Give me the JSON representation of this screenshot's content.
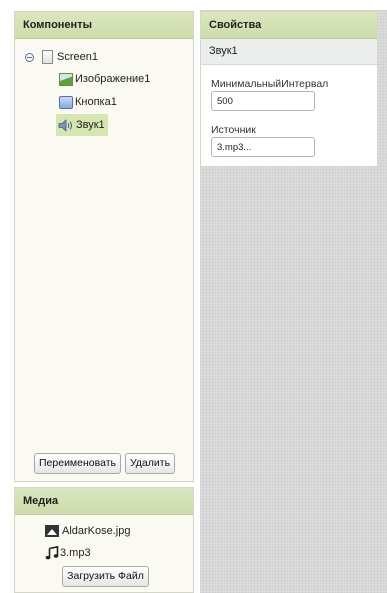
{
  "components_panel": {
    "title": "Компоненты",
    "tree": {
      "root": "Screen1",
      "children": [
        "Изображение1",
        "Кнопка1",
        "Звук1"
      ],
      "selected": "Звук1"
    },
    "rename_button": "Переименовать",
    "delete_button": "Удалить"
  },
  "properties_panel": {
    "title": "Свойства",
    "component_name": "Звук1",
    "min_interval_label": "МинимальныйИнтервал",
    "min_interval_value": "500",
    "source_label": "Источник",
    "source_value": "3.mp3..."
  },
  "media_panel": {
    "title": "Медиа",
    "files": [
      "AldarKose.jpg",
      "3.mp3"
    ],
    "upload_button": "Загрузить Файл"
  },
  "icons": {
    "collapse": "collapse-toggle-icon",
    "screen": "screen-icon",
    "image": "image-component-icon",
    "button": "button-component-icon",
    "sound": "sound-component-icon",
    "photo": "image-file-icon",
    "music": "audio-file-icon"
  }
}
